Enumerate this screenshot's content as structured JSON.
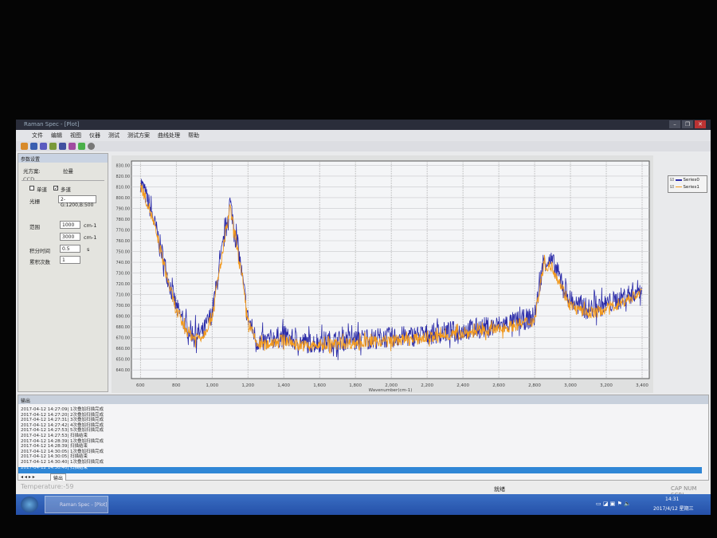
{
  "window": {
    "title": "Raman Spec - [Plot]",
    "controls": [
      "–",
      "❐",
      "✕"
    ]
  },
  "menu": [
    "文件",
    "编辑",
    "视图",
    "仪器",
    "测试",
    "测试方案",
    "曲线处理",
    "帮助"
  ],
  "left_panel": {
    "title": "参数设置",
    "scheme_label": "光方案:",
    "scheme_value": "拉曼",
    "group": "CCD",
    "single_label": "单道",
    "single_checked": false,
    "multi_label": "多道",
    "multi_checked": true,
    "grating_label": "光栅",
    "grating_value": "2-G:1200,B:500",
    "range_label": "范围",
    "range_from": "1000",
    "range_to": "3000",
    "range_unit": "cm-1",
    "integration_label": "积分时间",
    "integration_value": "0.5",
    "integration_unit": "s",
    "accum_label": "累积次数",
    "accum_value": "1"
  },
  "chart_data": {
    "type": "line",
    "xlabel": "Wavenumber(cm-1)",
    "ylabel": "",
    "xlim": [
      550,
      3440
    ],
    "ylim": [
      632,
      834
    ],
    "xticks": [
      "600",
      "800",
      "1,000",
      "1,200",
      "1,400",
      "1,600",
      "1,800",
      "2,000",
      "2,200",
      "2,400",
      "2,600",
      "2,800",
      "3,000",
      "3,200",
      "3,400"
    ],
    "yticks": [
      "830.00",
      "820.00",
      "810.00",
      "800.00",
      "790.00",
      "780.00",
      "770.00",
      "760.00",
      "750.00",
      "740.00",
      "730.00",
      "720.00",
      "710.00",
      "700.00",
      "690.00",
      "680.00",
      "670.00",
      "660.00",
      "650.00",
      "640.00"
    ],
    "grid": true,
    "legend": "right",
    "x": [
      600,
      650,
      700,
      750,
      800,
      850,
      900,
      950,
      1000,
      1050,
      1100,
      1150,
      1200,
      1250,
      1300,
      1350,
      1400,
      1450,
      1500,
      1550,
      1600,
      1650,
      1700,
      1750,
      1800,
      1850,
      1900,
      1950,
      2000,
      2050,
      2100,
      2150,
      2200,
      2250,
      2300,
      2350,
      2400,
      2450,
      2500,
      2550,
      2600,
      2650,
      2700,
      2750,
      2800,
      2850,
      2900,
      2950,
      3000,
      3050,
      3100,
      3150,
      3200,
      3250,
      3300,
      3350,
      3400
    ],
    "series": [
      {
        "name": "Series0",
        "color": "#2b2ba8",
        "values": [
          815,
          793,
          763,
          728,
          698,
          681,
          673,
          675,
          693,
          744,
          796,
          748,
          688,
          667,
          666,
          670,
          671,
          668,
          666,
          665,
          666,
          667,
          667,
          668,
          668,
          669,
          669,
          670,
          670,
          671,
          671,
          672,
          673,
          674,
          675,
          676,
          677,
          678,
          679,
          680,
          681,
          683,
          685,
          687,
          689,
          742,
          740,
          722,
          704,
          699,
          697,
          698,
          701,
          704,
          708,
          712,
          716
        ]
      },
      {
        "name": "Series1",
        "color": "#f29a1e",
        "values": [
          812,
          790,
          760,
          725,
          695,
          678,
          670,
          672,
          690,
          740,
          790,
          745,
          685,
          664,
          663,
          667,
          668,
          665,
          663,
          662,
          663,
          664,
          664,
          665,
          665,
          666,
          666,
          667,
          667,
          668,
          668,
          669,
          670,
          671,
          672,
          673,
          674,
          675,
          676,
          677,
          678,
          680,
          682,
          684,
          686,
          738,
          735,
          718,
          700,
          695,
          693,
          694,
          697,
          700,
          704,
          708,
          712
        ]
      }
    ]
  },
  "output": {
    "title": "输出",
    "lines": [
      "2017-04-12 14:27:09| 1次叠加扫描完成",
      "2017-04-12 14:27:20| 2次叠加扫描完成",
      "2017-04-12 14:27:31| 3次叠加扫描完成",
      "2017-04-12 14:27:42| 4次叠加扫描完成",
      "2017-04-12 14:27:53| 5次叠加扫描完成",
      "2017-04-12 14:27:53| 扫描结束",
      "2017-04-12 14:28:39| 1次叠加扫描完成",
      "2017-04-12 14:28:39| 扫描结束",
      "2017-04-12 14:30:05| 1次叠加扫描完成",
      "2017-04-12 14:30:05| 扫描结束",
      "2017-04-12 14:30:40| 1次叠加扫描完成",
      "2017-04-12 14:30:40| 扫描结束"
    ],
    "tab": "输出"
  },
  "status": {
    "temperature": "Temperature:-59",
    "ready": "就绪",
    "indicators": "CAP NUM SCRL"
  },
  "taskbar": {
    "app": "Raman Spec - [Plot]",
    "time": "14:31",
    "date": "2017/4/12 星期三"
  }
}
